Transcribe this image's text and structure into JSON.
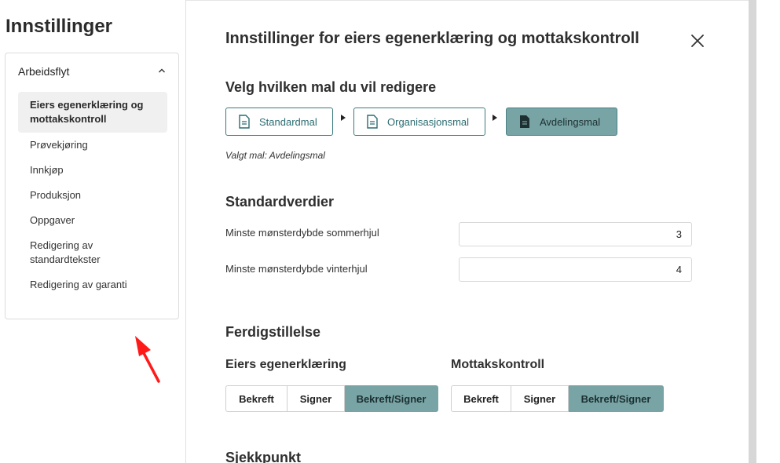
{
  "settings": {
    "title": "Innstillinger",
    "section_header": "Arbeidsflyt",
    "items": [
      {
        "label": "Eiers egenerklæring og mottakskontroll",
        "active": true
      },
      {
        "label": "Prøvekjøring"
      },
      {
        "label": "Innkjøp"
      },
      {
        "label": "Produksjon"
      },
      {
        "label": "Oppgaver"
      },
      {
        "label": "Redigering av standardtekster"
      },
      {
        "label": "Redigering av garanti"
      }
    ]
  },
  "panel": {
    "title": "Innstillinger for eiers egenerklæring og mottakskontroll",
    "template_section": {
      "heading": "Velg hvilken mal du vil redigere",
      "templates": [
        "Standardmal",
        "Organisasjonsmal",
        "Avdelingsmal"
      ],
      "selected": "Avdelingsmal",
      "selected_text": "Valgt mal: Avdelingsmal"
    },
    "defaults_section": {
      "heading": "Standardverdier",
      "fields": [
        {
          "label": "Minste mønsterdybde sommerhjul",
          "value": "3"
        },
        {
          "label": "Minste mønsterdybde vinterhjul",
          "value": "4"
        }
      ]
    },
    "completion_section": {
      "heading": "Ferdigstillelse",
      "groups": [
        {
          "label": "Eiers egenerklæring",
          "options": [
            "Bekreft",
            "Signer",
            "Bekreft/Signer"
          ],
          "selected": "Bekreft/Signer"
        },
        {
          "label": "Mottakskontroll",
          "options": [
            "Bekreft",
            "Signer",
            "Bekreft/Signer"
          ],
          "selected": "Bekreft/Signer"
        }
      ]
    },
    "next_section_heading": "Sjekkpunkt"
  },
  "colors": {
    "accent": "#78a4a6",
    "accent_border": "#3a7a7e",
    "annotation": "#ff0000"
  },
  "icons": {
    "collapse": "chevron-up-icon",
    "close": "close-icon",
    "template": "document-icon",
    "step": "triangle-right-icon",
    "annotation": "red-arrow-icon"
  }
}
